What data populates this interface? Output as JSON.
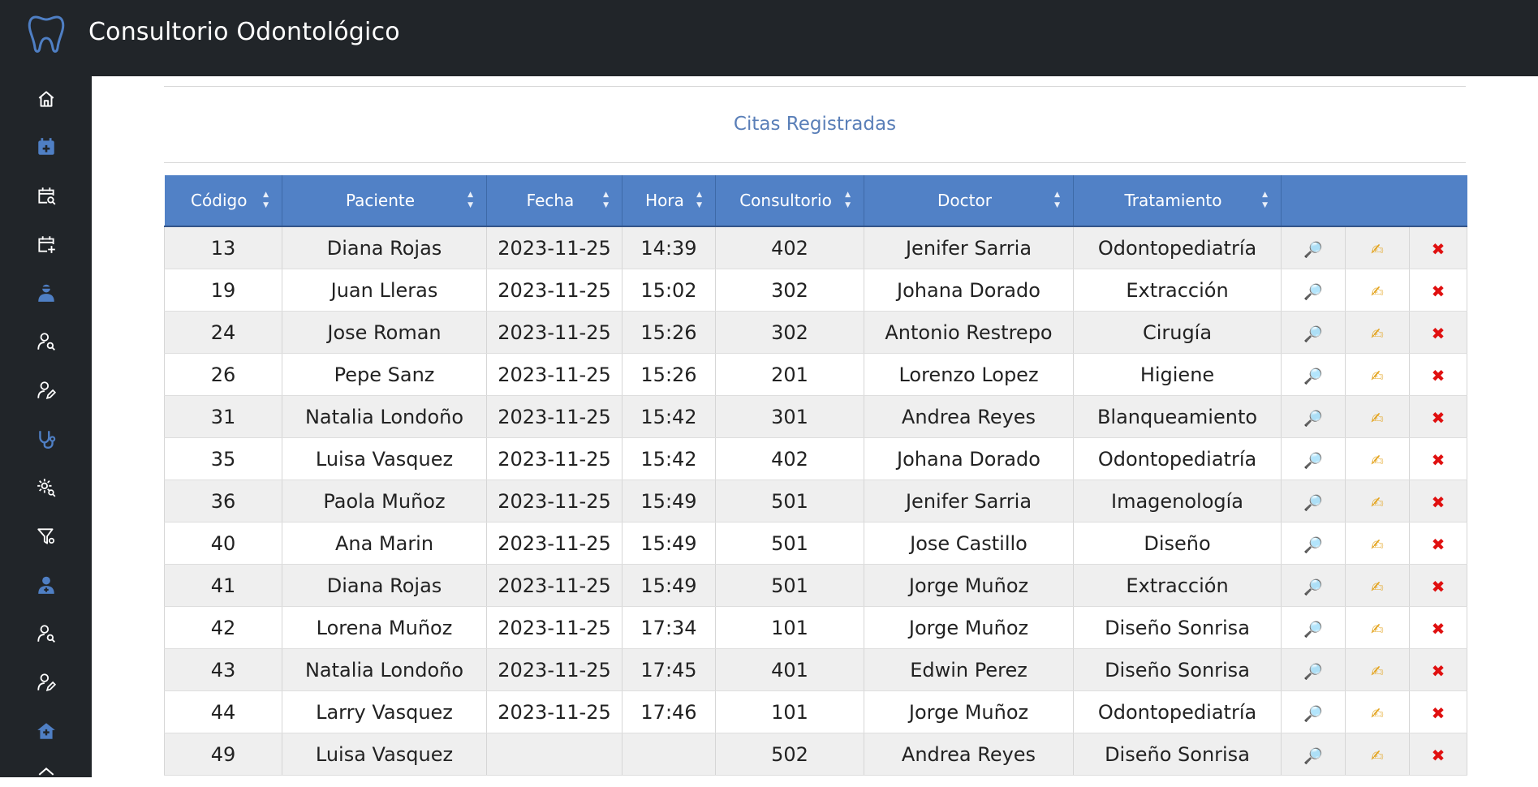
{
  "app": {
    "title": "Consultorio Odontológico",
    "logo_icon": "tooth-icon"
  },
  "sidebar": {
    "items": [
      {
        "icon": "home-icon",
        "active": false
      },
      {
        "icon": "calendar-plus-filled-icon",
        "active": true
      },
      {
        "icon": "calendar-search-icon",
        "active": false
      },
      {
        "icon": "calendar-add-icon",
        "active": false
      },
      {
        "icon": "patient-filled-icon",
        "active": true
      },
      {
        "icon": "user-search-icon",
        "active": false
      },
      {
        "icon": "user-edit-icon",
        "active": false
      },
      {
        "icon": "stethoscope-icon",
        "active": true
      },
      {
        "icon": "gear-search-icon",
        "active": false
      },
      {
        "icon": "filter-settings-icon",
        "active": false
      },
      {
        "icon": "doctor-filled-icon",
        "active": true
      },
      {
        "icon": "user-search-icon",
        "active": false
      },
      {
        "icon": "user-edit-icon",
        "active": false
      },
      {
        "icon": "clinic-filled-icon",
        "active": true
      }
    ]
  },
  "page": {
    "section_title": "Citas Registradas"
  },
  "table": {
    "columns": [
      "Código",
      "Paciente",
      "Fecha",
      "Hora",
      "Consultorio",
      "Doctor",
      "Tratamiento",
      ""
    ],
    "actions": {
      "view_icon": "🔎",
      "edit_icon": "✍",
      "delete_icon": "✖"
    },
    "rows": [
      {
        "codigo": "13",
        "paciente": "Diana Rojas",
        "fecha": "2023-11-25",
        "hora": "14:39",
        "consultorio": "402",
        "doctor": "Jenifer Sarria",
        "tratamiento": "Odontopediatría"
      },
      {
        "codigo": "19",
        "paciente": "Juan Lleras",
        "fecha": "2023-11-25",
        "hora": "15:02",
        "consultorio": "302",
        "doctor": "Johana Dorado",
        "tratamiento": "Extracción"
      },
      {
        "codigo": "24",
        "paciente": "Jose Roman",
        "fecha": "2023-11-25",
        "hora": "15:26",
        "consultorio": "302",
        "doctor": "Antonio Restrepo",
        "tratamiento": "Cirugía"
      },
      {
        "codigo": "26",
        "paciente": "Pepe Sanz",
        "fecha": "2023-11-25",
        "hora": "15:26",
        "consultorio": "201",
        "doctor": "Lorenzo Lopez",
        "tratamiento": "Higiene"
      },
      {
        "codigo": "31",
        "paciente": "Natalia Londoño",
        "fecha": "2023-11-25",
        "hora": "15:42",
        "consultorio": "301",
        "doctor": "Andrea Reyes",
        "tratamiento": "Blanqueamiento"
      },
      {
        "codigo": "35",
        "paciente": "Luisa Vasquez",
        "fecha": "2023-11-25",
        "hora": "15:42",
        "consultorio": "402",
        "doctor": "Johana Dorado",
        "tratamiento": "Odontopediatría"
      },
      {
        "codigo": "36",
        "paciente": "Paola Muñoz",
        "fecha": "2023-11-25",
        "hora": "15:49",
        "consultorio": "501",
        "doctor": "Jenifer Sarria",
        "tratamiento": "Imagenología"
      },
      {
        "codigo": "40",
        "paciente": "Ana Marin",
        "fecha": "2023-11-25",
        "hora": "15:49",
        "consultorio": "501",
        "doctor": "Jose Castillo",
        "tratamiento": "Diseño"
      },
      {
        "codigo": "41",
        "paciente": "Diana Rojas",
        "fecha": "2023-11-25",
        "hora": "15:49",
        "consultorio": "501",
        "doctor": "Jorge Muñoz",
        "tratamiento": "Extracción"
      },
      {
        "codigo": "42",
        "paciente": "Lorena Muñoz",
        "fecha": "2023-11-25",
        "hora": "17:34",
        "consultorio": "101",
        "doctor": "Jorge Muñoz",
        "tratamiento": "Diseño Sonrisa"
      },
      {
        "codigo": "43",
        "paciente": "Natalia Londoño",
        "fecha": "2023-11-25",
        "hora": "17:45",
        "consultorio": "401",
        "doctor": "Edwin Perez",
        "tratamiento": "Diseño Sonrisa"
      },
      {
        "codigo": "44",
        "paciente": "Larry Vasquez",
        "fecha": "2023-11-25",
        "hora": "17:46",
        "consultorio": "101",
        "doctor": "Jorge Muñoz",
        "tratamiento": "Odontopediatría"
      },
      {
        "codigo": "49",
        "paciente": "Luisa Vasquez",
        "fecha": "",
        "hora": "",
        "consultorio": "502",
        "doctor": "Andrea Reyes",
        "tratamiento": "Diseño Sonrisa"
      }
    ]
  },
  "colors": {
    "topbar": "#212529",
    "header_blue": "#5181c6",
    "title_blue": "#5a7fb8",
    "icon_blue": "#4f7fc4",
    "row_stripe": "#efefef"
  }
}
